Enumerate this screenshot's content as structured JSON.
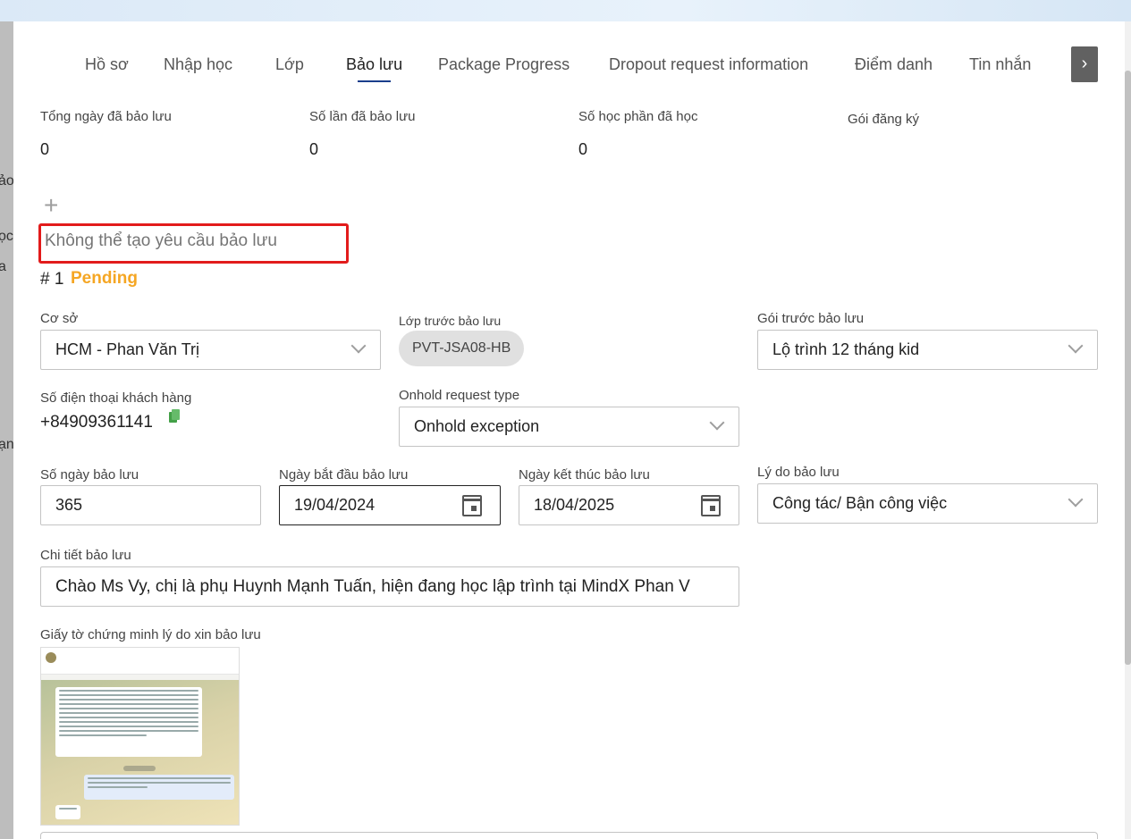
{
  "tabs": [
    {
      "label": "Hồ sơ"
    },
    {
      "label": "Nhập học"
    },
    {
      "label": "Lớp"
    },
    {
      "label": "Bảo lưu"
    },
    {
      "label": "Package Progress"
    },
    {
      "label": "Dropout request information"
    },
    {
      "label": "Điểm danh"
    },
    {
      "label": "Tin nhắn"
    }
  ],
  "active_tab": "Bảo lưu",
  "tab_next_icon": "chevron-right-icon",
  "summary": {
    "total_days_label": "Tổng ngày đã bảo lưu",
    "total_days_value": "0",
    "count_label": "Số lần đã bảo lưu",
    "count_value": "0",
    "modules_label": "Số học phần đã học",
    "modules_value": "0",
    "package_label": "Gói đăng ký"
  },
  "add_icon": "plus-icon",
  "warning_text": "Không thể tạo yêu cầu bảo lưu",
  "warning_color": "#e21b1b",
  "request": {
    "number": "# 1",
    "status": "Pending",
    "status_color": "#f5a623"
  },
  "form": {
    "campus_label": "Cơ sở",
    "campus_value": "HCM - Phan Văn Trị",
    "class_label": "Lớp trước bảo lưu",
    "class_value": "PVT-JSA08-HB",
    "package_before_label": "Gói trước bảo lưu",
    "package_before_value": "Lộ trình 12 tháng kid",
    "phone_label": "Số điện thoại khách hàng",
    "phone_value": "+84909361141",
    "copy_icon": "copy-icon",
    "onhold_type_label": "Onhold request type",
    "onhold_type_value": "Onhold exception",
    "days_label": "Số ngày bảo lưu",
    "days_value": "365",
    "start_label": "Ngày bắt đầu bảo lưu",
    "start_value": "19/04/2024",
    "end_label": "Ngày kết thúc bảo lưu",
    "end_value": "18/04/2025",
    "reason_label": "Lý do bảo lưu",
    "reason_value": "Công tác/ Bận công việc",
    "detail_label": "Chi tiết bảo lưu",
    "detail_value": "Chào Ms Vy, chị là phụ Huynh Mạnh Tuấn, hiện đang học lập trình tại MindX Phan V",
    "proof_label": "Giấy tờ chứng minh lý do xin bảo lưu"
  }
}
